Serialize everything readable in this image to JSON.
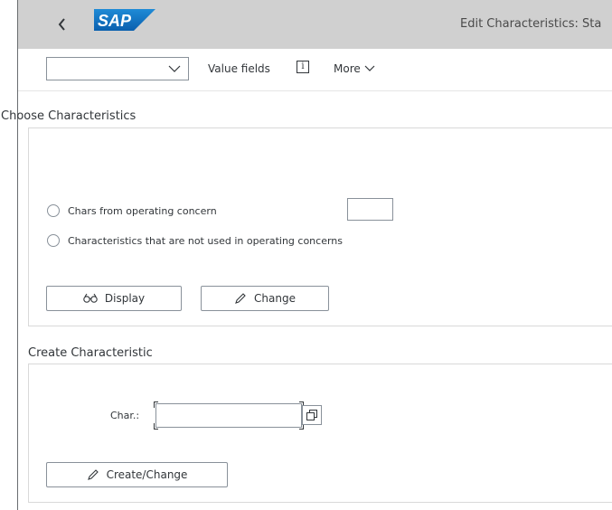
{
  "shell": {
    "back_icon": "chevron-left-icon",
    "logo": "SAP",
    "title": "Edit Characteristics: Sta"
  },
  "toolbar": {
    "select_value": "",
    "value_fields": "Value fields",
    "info_icon_glyph": "i",
    "more": "More"
  },
  "choose": {
    "title": "Choose Characteristics",
    "radio1": "Chars from operating concern",
    "radio1_input_value": "",
    "radio2": "Characteristics that are not used in operating concerns",
    "display_button": "Display",
    "change_button": "Change"
  },
  "create": {
    "title": "Create Characteristic",
    "char_label": "Char.:",
    "char_value": "",
    "create_change_button": "Create/Change"
  },
  "colors": {
    "shell_bg": "#d0d0d0",
    "logo_blue": "#0a6ed1",
    "border": "#89919a"
  }
}
